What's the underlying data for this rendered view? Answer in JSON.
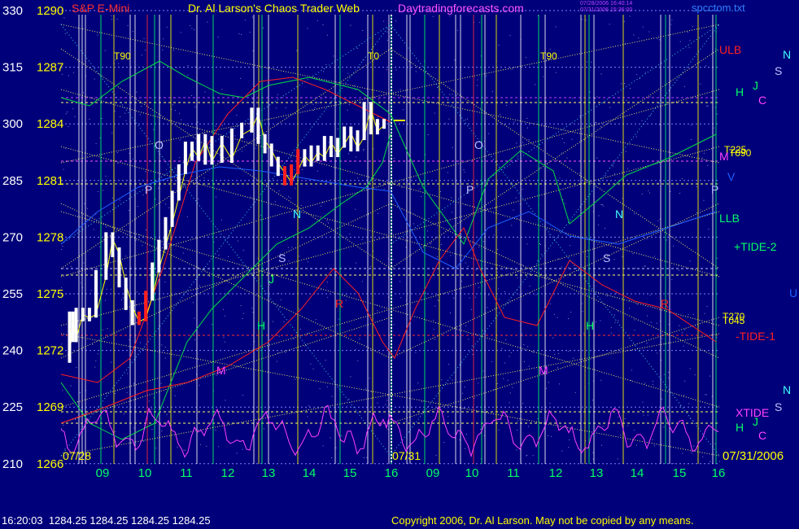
{
  "header": {
    "symbol": "S&P E-Mini",
    "title": "Dr. Al Larson's Chaos Trader Web",
    "site": "Daytradingforecasts.com",
    "stamp1": "07/28/2006 16:40:14",
    "stamp2": "07/31/2006 15:36:00",
    "file": "spcctom.txt"
  },
  "footer": {
    "quote": "16:20:03  1284.25 1284.25 1284.25 1284.25",
    "copyright": "Copyright 2006, Dr. Al Larson. May not be copied by any means."
  },
  "chart_data": {
    "type": "line",
    "y_left_angle": [
      "330",
      "315",
      "300",
      "285",
      "270",
      "255",
      "240",
      "225",
      "210"
    ],
    "y_left_price": [
      "1290",
      "1287",
      "1284",
      "1281",
      "1278",
      "1275",
      "1272",
      "1269",
      "1266"
    ],
    "x_ticks": [
      "09",
      "10",
      "11",
      "12",
      "13",
      "14",
      "15",
      "16",
      "09",
      "10",
      "11",
      "12",
      "13",
      "14",
      "15",
      "16"
    ],
    "dates": [
      "07/28",
      "07/31",
      "07/31/2006"
    ],
    "cycle_labels": [
      "T90",
      "T0",
      "T90",
      "T225",
      "T270",
      "T090",
      "T045"
    ],
    "planet_labels": [
      "O",
      "P",
      "N",
      "S",
      "J",
      "H",
      "M",
      "R",
      "U",
      "V",
      "C"
    ],
    "right_labels": [
      "ULB",
      "LLB",
      "+TIDE-2",
      "-TIDE-1",
      "XTIDE"
    ],
    "price_series": [
      {
        "t": 0.0,
        "p": 1271.6
      },
      {
        "t": 0.05,
        "p": 1273.8
      },
      {
        "t": 0.1,
        "p": 1272.7
      },
      {
        "t": 0.2,
        "p": 1274.0
      },
      {
        "t": 0.3,
        "p": 1273.8
      },
      {
        "t": 0.4,
        "p": 1274.0
      },
      {
        "t": 0.55,
        "p": 1276.0
      },
      {
        "t": 0.65,
        "p": 1278.0
      },
      {
        "t": 0.75,
        "p": 1277.2
      },
      {
        "t": 0.85,
        "p": 1275.6
      },
      {
        "t": 0.95,
        "p": 1274.4
      },
      {
        "t": 1.05,
        "p": 1273.6
      },
      {
        "t": 1.15,
        "p": 1273.8
      },
      {
        "t": 1.25,
        "p": 1274.9
      },
      {
        "t": 1.35,
        "p": 1276.4
      },
      {
        "t": 1.45,
        "p": 1277.6
      },
      {
        "t": 1.55,
        "p": 1278.8
      },
      {
        "t": 1.65,
        "p": 1280.2
      },
      {
        "t": 1.75,
        "p": 1281.6
      },
      {
        "t": 1.85,
        "p": 1282.8
      },
      {
        "t": 1.95,
        "p": 1282.3
      },
      {
        "t": 2.05,
        "p": 1283.2
      },
      {
        "t": 2.15,
        "p": 1282.1
      },
      {
        "t": 2.3,
        "p": 1283.1
      },
      {
        "t": 2.45,
        "p": 1282.2
      },
      {
        "t": 2.6,
        "p": 1283.5
      },
      {
        "t": 2.75,
        "p": 1283.8
      },
      {
        "t": 2.85,
        "p": 1284.6
      },
      {
        "t": 2.95,
        "p": 1283.2
      },
      {
        "t": 3.05,
        "p": 1282.7
      },
      {
        "t": 3.15,
        "p": 1282.0
      },
      {
        "t": 3.25,
        "p": 1281.5
      },
      {
        "t": 3.35,
        "p": 1281.0
      },
      {
        "t": 3.45,
        "p": 1281.6
      },
      {
        "t": 3.55,
        "p": 1282.4
      },
      {
        "t": 3.65,
        "p": 1282.0
      },
      {
        "t": 3.75,
        "p": 1282.6
      },
      {
        "t": 3.85,
        "p": 1282.3
      },
      {
        "t": 3.95,
        "p": 1283.1
      },
      {
        "t": 4.05,
        "p": 1282.5
      },
      {
        "t": 4.15,
        "p": 1283.0
      },
      {
        "t": 4.25,
        "p": 1283.6
      },
      {
        "t": 4.35,
        "p": 1282.8
      },
      {
        "t": 4.45,
        "p": 1283.4
      },
      {
        "t": 4.55,
        "p": 1284.9
      },
      {
        "t": 4.65,
        "p": 1283.7
      },
      {
        "t": 4.75,
        "p": 1284.0
      }
    ]
  }
}
